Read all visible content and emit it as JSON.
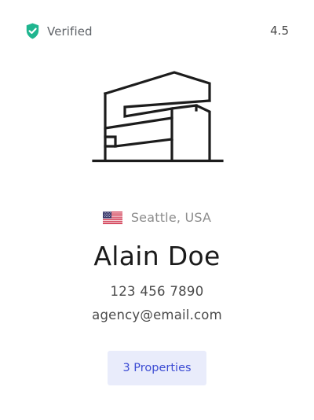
{
  "badge": {
    "icon": "shield-check-icon",
    "label": "Verified",
    "color": "#1fb58f"
  },
  "rating": "4.5",
  "logo": {
    "icon": "building-logo"
  },
  "location": {
    "flag": "us-flag-icon",
    "text": "Seattle, USA"
  },
  "agent": {
    "name": "Alain Doe",
    "phone": "123 456 7890",
    "email": "agency@email.com"
  },
  "properties_button": {
    "label": "3 Properties",
    "background": "#e9ecfb",
    "text_color": "#3b4bd3"
  }
}
